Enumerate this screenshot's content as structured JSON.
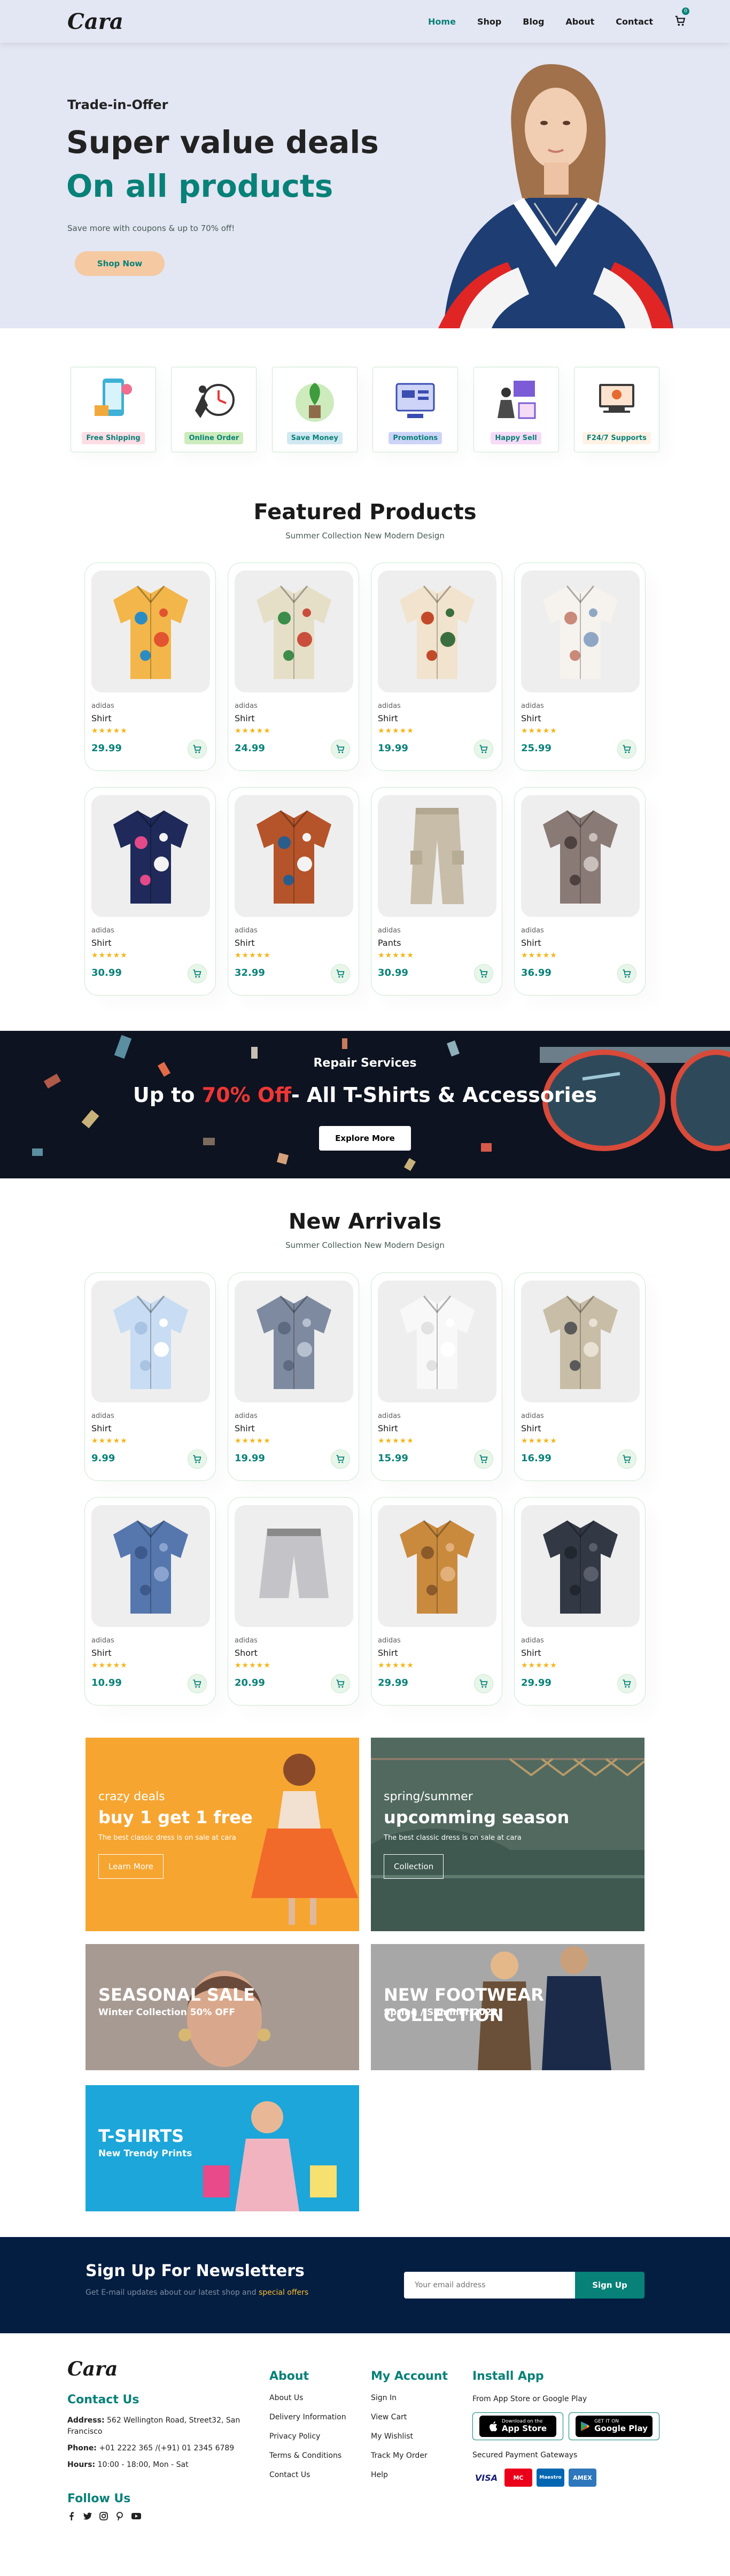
{
  "header": {
    "logo_text": "Cara",
    "nav": [
      {
        "label": "Home"
      },
      {
        "label": "Shop"
      },
      {
        "label": "Blog"
      },
      {
        "label": "About"
      },
      {
        "label": "Contact"
      }
    ],
    "cart_count": "0",
    "active_color": "#088178"
  },
  "hero": {
    "kicker": "Trade-in-Offer",
    "title_line1": "Super value deals",
    "title_line2": "On all products",
    "subtitle": "Save more with coupons & up to 70% off!",
    "button_label": "Shop Now"
  },
  "features": [
    {
      "label": "Free Shipping",
      "bg": "#fddde4"
    },
    {
      "label": "Online Order",
      "bg": "#cdebbc"
    },
    {
      "label": "Save Money",
      "bg": "#d1e8f2"
    },
    {
      "label": "Promotions",
      "bg": "#cdd4f8"
    },
    {
      "label": "Happy Sell",
      "bg": "#f6dbf6"
    },
    {
      "label": "F24/7 Supports",
      "bg": "#fff2e5"
    }
  ],
  "featured": {
    "title": "Featured Products",
    "subtitle": "Summer Collection New Modern Design",
    "products": [
      {
        "brand": "adidas",
        "name": "Shirt",
        "stars": "★★★★★",
        "price": "29.99",
        "icon": "floral-shirt-multicolor"
      },
      {
        "brand": "adidas",
        "name": "Shirt",
        "stars": "★★★★★",
        "price": "24.99",
        "icon": "floral-shirt-green"
      },
      {
        "brand": "adidas",
        "name": "Shirt",
        "stars": "★★★★★",
        "price": "19.99",
        "icon": "floral-shirt-orange"
      },
      {
        "brand": "adidas",
        "name": "Shirt",
        "stars": "★★★★★",
        "price": "25.99",
        "icon": "floral-shirt-white"
      },
      {
        "brand": "adidas",
        "name": "Shirt",
        "stars": "★★★★★",
        "price": "30.99",
        "icon": "floral-shirt-navy"
      },
      {
        "brand": "adidas",
        "name": "Shirt",
        "stars": "★★★★★",
        "price": "32.99",
        "icon": "patchwork-shirt"
      },
      {
        "brand": "adidas",
        "name": "Pants",
        "stars": "★★★★★",
        "price": "30.99",
        "icon": "cargo-pants"
      },
      {
        "brand": "adidas",
        "name": "Shirt",
        "stars": "★★★★★",
        "price": "36.99",
        "icon": "paisley-blouse"
      }
    ]
  },
  "banner": {
    "kicker": "Repair Services",
    "title_pre": "Up to",
    "title_highlight": "70% Off",
    "title_post": "- All T-Shirts & Accessories",
    "button_label": "Explore More"
  },
  "arrivals": {
    "title": "New Arrivals",
    "subtitle": "Summer Collection New Modern Design",
    "products": [
      {
        "brand": "adidas",
        "name": "Shirt",
        "stars": "★★★★★",
        "price": "9.99",
        "icon": "light-blue-shirt"
      },
      {
        "brand": "adidas",
        "name": "Shirt",
        "stars": "★★★★★",
        "price": "19.99",
        "icon": "gray-check-shirt"
      },
      {
        "brand": "adidas",
        "name": "Shirt",
        "stars": "★★★★★",
        "price": "15.99",
        "icon": "white-shirt"
      },
      {
        "brand": "adidas",
        "name": "Shirt",
        "stars": "★★★★★",
        "price": "16.99",
        "icon": "khaki-print-shirt"
      },
      {
        "brand": "adidas",
        "name": "Shirt",
        "stars": "★★★★★",
        "price": "10.99",
        "icon": "denim-shirt"
      },
      {
        "brand": "adidas",
        "name": "Short",
        "stars": "★★★★★",
        "price": "20.99",
        "icon": "gray-shorts"
      },
      {
        "brand": "adidas",
        "name": "Shirt",
        "stars": "★★★★★",
        "price": "29.99",
        "icon": "tan-jacket"
      },
      {
        "brand": "adidas",
        "name": "Shirt",
        "stars": "★★★★★",
        "price": "29.99",
        "icon": "dark-shirt"
      }
    ]
  },
  "small_banners": {
    "deal": {
      "kicker": "crazy deals",
      "title": "buy 1 get 1 free",
      "text": "The best classic dress is on sale at cara",
      "button": "Learn More"
    },
    "season": {
      "kicker": "spring/summer",
      "title": "upcomming season",
      "text": "The best classic dress is on sale at cara",
      "button": "Collection"
    },
    "seasonal_sale": {
      "title": "SEASONAL SALE",
      "subtitle": "Winter Collection 50% OFF"
    },
    "footwear": {
      "title": "NEW FOOTWEAR COLLECTION",
      "subtitle": "Spring / Summer 2022"
    },
    "tshirts": {
      "title": "T-SHIRTS",
      "subtitle": "New Trendy Prints"
    }
  },
  "newsletter": {
    "title": "Sign Up For Newsletters",
    "subtitle_pre": "Get E-mail updates about our latest shop and",
    "subtitle_hl": "special offers",
    "placeholder": "Your email address",
    "button": "Sign Up"
  },
  "footer": {
    "logo_text": "Cara",
    "contact_title": "Contact Us",
    "address_label": "Address:",
    "address": "562 Wellington Road, Street32, San Francisco",
    "phone_label": "Phone:",
    "phone": "+01 2222 365 /(+91) 01 2345 6789",
    "hours_label": "Hours:",
    "hours": "10:00 - 18:00, Mon - Sat",
    "follow_title": "Follow Us",
    "about_title": "About",
    "about_links": [
      "About Us",
      "Delivery Information",
      "Privacy Policy",
      "Terms & Conditions",
      "Contact Us"
    ],
    "account_title": "My Account",
    "account_links": [
      "Sign In",
      "View Cart",
      "My Wishlist",
      "Track My Order",
      "Help"
    ],
    "install_title": "Install App",
    "install_sub": "From App Store or Google Play",
    "appstore_small": "Download on the",
    "appstore_big": "App Store",
    "gplay_small": "GET IT ON",
    "gplay_big": "Google Play",
    "gateways": "Secured Payment Gateways",
    "cards": [
      "VISA",
      "MC",
      "Maestro",
      "AMEX"
    ]
  }
}
